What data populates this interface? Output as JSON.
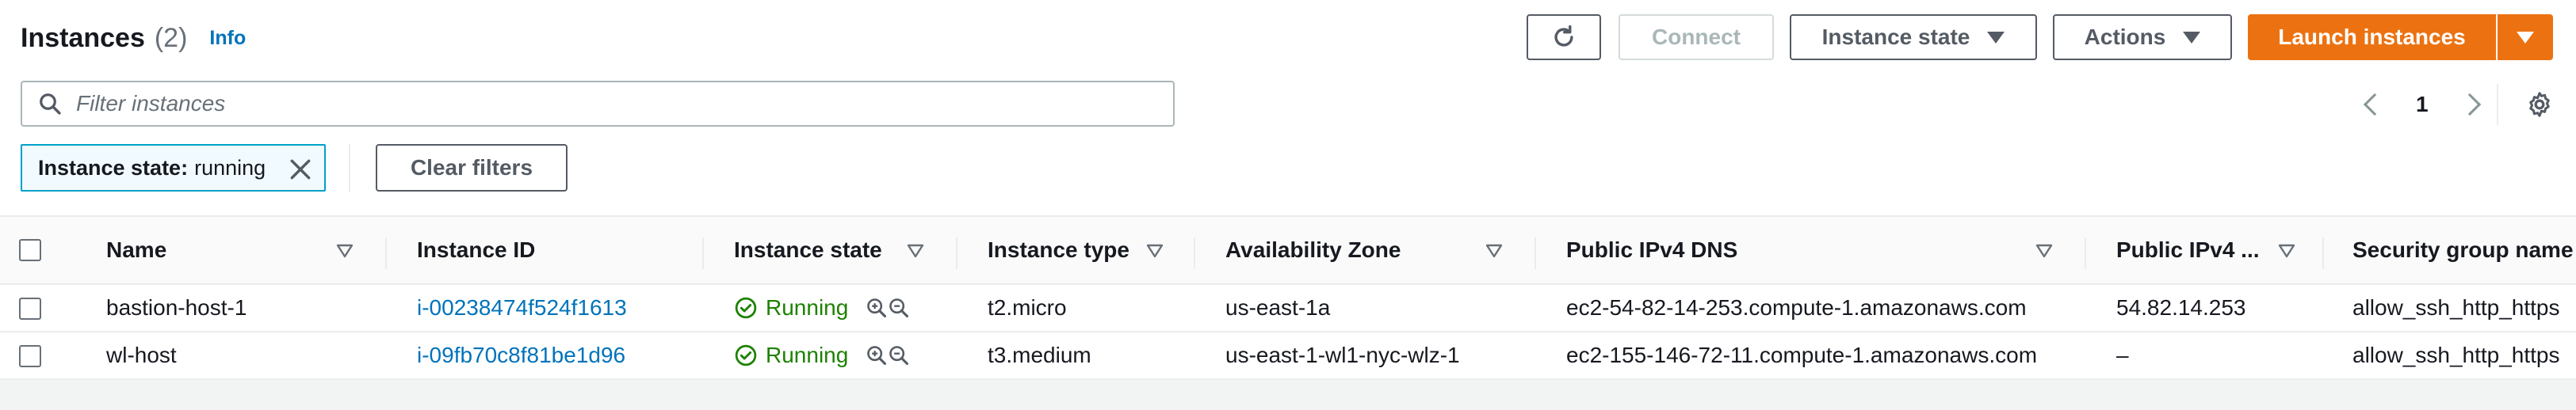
{
  "header": {
    "title": "Instances",
    "count": "(2)",
    "info_label": "Info"
  },
  "toolbar": {
    "refresh_icon": "refresh-icon",
    "connect_label": "Connect",
    "instance_state_label": "Instance state",
    "actions_label": "Actions",
    "launch_label": "Launch instances"
  },
  "search": {
    "placeholder": "Filter instances",
    "value": ""
  },
  "pagination": {
    "current_page": "1"
  },
  "filter_chip": {
    "key": "Instance state:",
    "value": "running"
  },
  "clear_filters_label": "Clear filters",
  "table": {
    "columns": [
      "Name",
      "Instance ID",
      "Instance state",
      "Instance type",
      "Availability Zone",
      "Public IPv4 DNS",
      "Public IPv4 ...",
      "Security group name"
    ],
    "rows": [
      {
        "name": "bastion-host-1",
        "instance_id": "i-00238474f524f1613",
        "state": "Running",
        "type": "t2.micro",
        "az": "us-east-1a",
        "dns": "ec2-54-82-14-253.compute-1.amazonaws.com",
        "ipv4": "54.82.14.253",
        "sg": "allow_ssh_http_https"
      },
      {
        "name": "wl-host",
        "instance_id": "i-09fb70c8f81be1d96",
        "state": "Running",
        "type": "t3.medium",
        "az": "us-east-1-wl1-nyc-wlz-1",
        "dns": "ec2-155-146-72-11.compute-1.amazonaws.com",
        "ipv4": "–",
        "sg": "allow_ssh_http_https"
      }
    ]
  },
  "colors": {
    "accent": "#ec7211",
    "link": "#0073bb",
    "running": "#1d8102"
  }
}
